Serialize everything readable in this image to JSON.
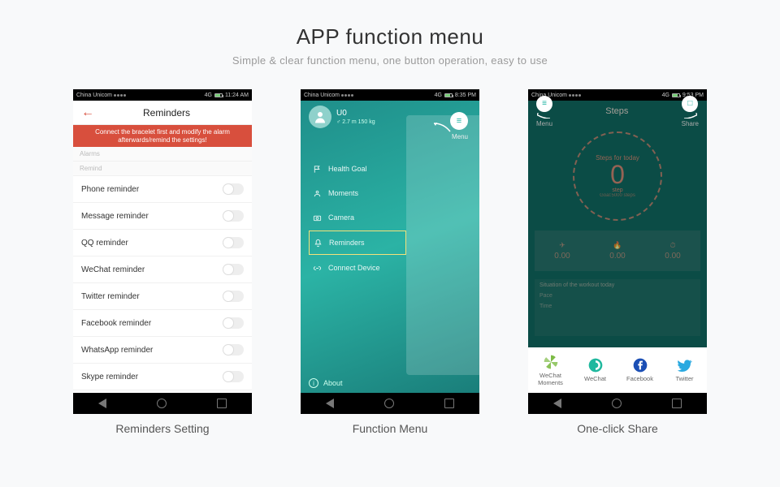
{
  "header": {
    "title": "APP function menu",
    "subtitle": "Simple & clear function menu, one button operation, easy to use"
  },
  "captions": {
    "p1": "Reminders Setting",
    "p2": "Function Menu",
    "p3": "One-click Share"
  },
  "statusbar": {
    "carrier": "China Unicom",
    "time1": "11:24 AM",
    "time2": "8:35 PM",
    "time3": "9:53 PM",
    "signal": "4G"
  },
  "p1": {
    "title": "Reminders",
    "banner": "Connect the bracelet first and modify the alarm afterwards/remind the settings!",
    "section1": "Alarms",
    "section2": "Remind",
    "rows": [
      {
        "label": "Phone reminder"
      },
      {
        "label": "Message reminder"
      },
      {
        "label": "QQ reminder"
      },
      {
        "label": "WeChat reminder"
      },
      {
        "label": "Twitter reminder"
      },
      {
        "label": "Facebook reminder"
      },
      {
        "label": "WhatsApp reminder"
      },
      {
        "label": "Skype reminder"
      }
    ]
  },
  "p2": {
    "menu_label": "Menu",
    "profile": {
      "name": "U0",
      "detail": "♂ 2.7 m 150 kg"
    },
    "items": [
      {
        "label": "Health Goal",
        "icon": "flag"
      },
      {
        "label": "Moments",
        "icon": "user"
      },
      {
        "label": "Camera",
        "icon": "camera"
      },
      {
        "label": "Reminders",
        "icon": "bell",
        "selected": true
      },
      {
        "label": "Connect Device",
        "icon": "link"
      }
    ],
    "about": "About"
  },
  "p3": {
    "title": "Steps",
    "menu": "Menu",
    "share": "Share",
    "circle": {
      "line1": "Steps for today",
      "line2": "0",
      "line3": "step",
      "line4": "Goal:5000 steps"
    },
    "stats": [
      {
        "icon": "✈",
        "value": "0.00"
      },
      {
        "icon": "🔥",
        "value": "0.00"
      },
      {
        "icon": "⏱",
        "value": "0.00"
      }
    ],
    "block": {
      "title": "Situation of the workout today",
      "rows": [
        "Pace",
        "Time"
      ]
    },
    "shareItems": [
      {
        "label": "WeChat Moments",
        "color": "#7dbb46"
      },
      {
        "label": "WeChat",
        "color": "#20b89e"
      },
      {
        "label": "Facebook",
        "color": "#1b4fb5"
      },
      {
        "label": "Twitter",
        "color": "#2aa9e0"
      }
    ]
  }
}
